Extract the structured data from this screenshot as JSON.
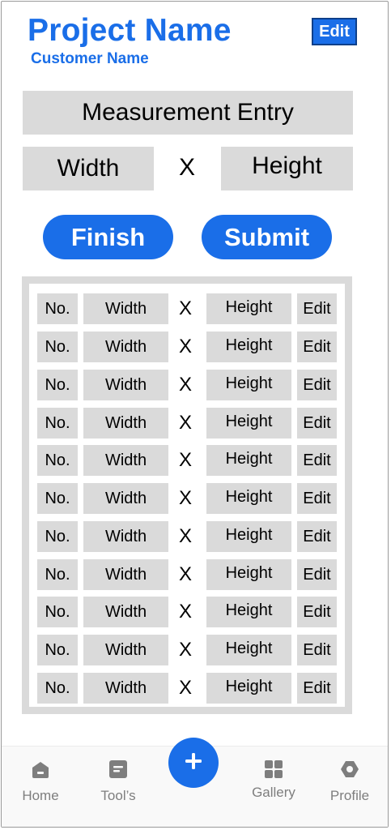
{
  "header": {
    "project_name": "Project Name",
    "customer_name": "Customer Name",
    "edit_label": "Edit"
  },
  "entry": {
    "title": "Measurement Entry",
    "width_label": "Width",
    "separator": "X",
    "height_label": "Height"
  },
  "actions": {
    "finish_label": "Finish",
    "submit_label": "Submit"
  },
  "table": {
    "rows": [
      {
        "no": "No.",
        "width": "Width",
        "x": "X",
        "height": "Height",
        "edit": "Edit"
      },
      {
        "no": "No.",
        "width": "Width",
        "x": "X",
        "height": "Height",
        "edit": "Edit"
      },
      {
        "no": "No.",
        "width": "Width",
        "x": "X",
        "height": "Height",
        "edit": "Edit"
      },
      {
        "no": "No.",
        "width": "Width",
        "x": "X",
        "height": "Height",
        "edit": "Edit"
      },
      {
        "no": "No.",
        "width": "Width",
        "x": "X",
        "height": "Height",
        "edit": "Edit"
      },
      {
        "no": "No.",
        "width": "Width",
        "x": "X",
        "height": "Height",
        "edit": "Edit"
      },
      {
        "no": "No.",
        "width": "Width",
        "x": "X",
        "height": "Height",
        "edit": "Edit"
      },
      {
        "no": "No.",
        "width": "Width",
        "x": "X",
        "height": "Height",
        "edit": "Edit"
      },
      {
        "no": "No.",
        "width": "Width",
        "x": "X",
        "height": "Height",
        "edit": "Edit"
      },
      {
        "no": "No.",
        "width": "Width",
        "x": "X",
        "height": "Height",
        "edit": "Edit"
      },
      {
        "no": "No.",
        "width": "Width",
        "x": "X",
        "height": "Height",
        "edit": "Edit"
      }
    ]
  },
  "nav": {
    "items": [
      {
        "label": "Home",
        "icon": "home-icon"
      },
      {
        "label": "Tool’s",
        "icon": "tools-icon"
      },
      {
        "label": "Gallery",
        "icon": "gallery-icon"
      },
      {
        "label": "Profile",
        "icon": "profile-icon"
      }
    ],
    "fab_icon": "plus-icon"
  },
  "colors": {
    "accent": "#1a6ee8",
    "field_grey": "#dadada",
    "nav_grey": "#7e7e7e"
  }
}
